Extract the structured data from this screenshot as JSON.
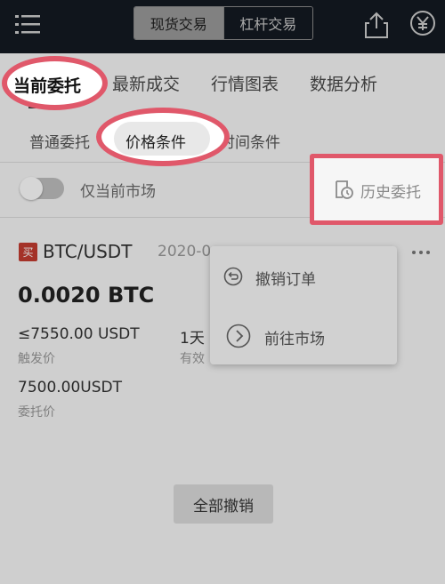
{
  "header": {
    "icons": {
      "menu": "menu-icon",
      "share": "share-icon",
      "currency": "yen-icon"
    },
    "segments": [
      "现货交易",
      "杠杆交易"
    ]
  },
  "tabs": [
    "当前委托",
    "最新成交",
    "行情图表",
    "数据分析"
  ],
  "subtabs": [
    "普通委托",
    "价格条件",
    "时间条件"
  ],
  "filter": {
    "toggle_label": "仅当前市场",
    "history_label": "历史委托",
    "history_icon": "history-icon"
  },
  "order": {
    "side_badge": "买",
    "pair": "BTC/USDT",
    "date": "2020-0",
    "amount": "0.0020 BTC",
    "trigger_value": "≤7550.00 USDT",
    "trigger_label": "触发价",
    "period_value": "1天",
    "period_label": "有效",
    "price_value": "7500.00USDT",
    "price_label": "委托价"
  },
  "popup": {
    "items": [
      {
        "label": "撤销订单",
        "icon": "undo-icon"
      },
      {
        "label": "前往市场",
        "icon": "chevron-right-circle-icon"
      }
    ]
  },
  "cancel_all_label": "全部撤销",
  "colors": {
    "header_bg": "#141a22",
    "highlight": "#e0586a",
    "buy_badge": "#c43c30"
  }
}
